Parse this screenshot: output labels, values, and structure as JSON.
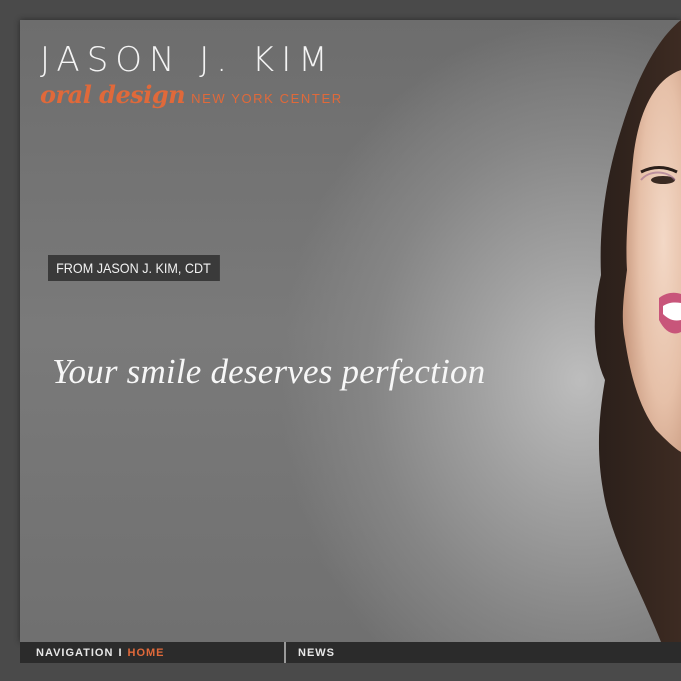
{
  "brand": {
    "name": "JASON J. KIM",
    "script": "oral design",
    "center": "NEW YORK CENTER",
    "accent_color": "#e0693a"
  },
  "hero": {
    "badge": "FROM JASON J. KIM, CDT",
    "tagline": "Your smile deserves perfection"
  },
  "nav": {
    "label": "NAVIGATION",
    "separator": "I",
    "home": "HOME",
    "news": "NEWS"
  }
}
